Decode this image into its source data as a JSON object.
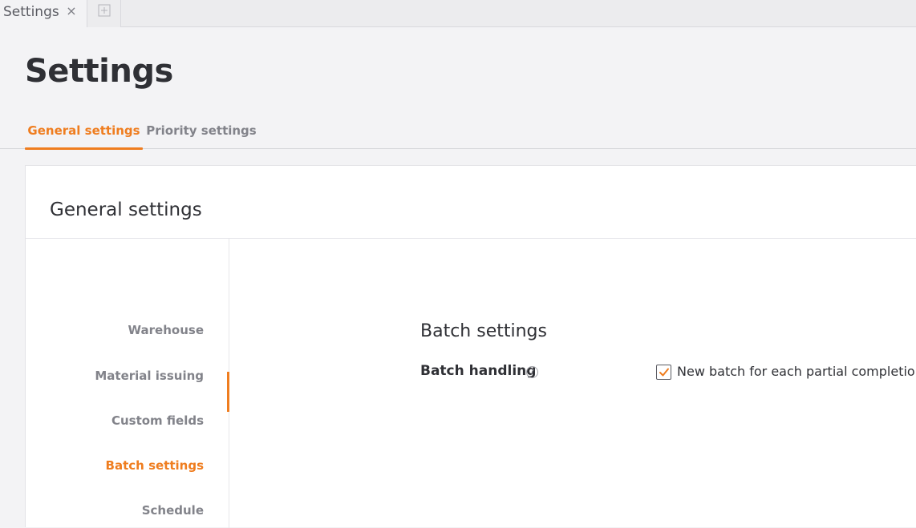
{
  "window": {
    "tab_label": "Settings",
    "close_glyph": "×"
  },
  "page": {
    "title": "Settings",
    "tabs": [
      {
        "label": "General settings",
        "active": true
      },
      {
        "label": "Priority settings",
        "active": false
      }
    ]
  },
  "card": {
    "title": "General settings",
    "nav": [
      {
        "label": "Warehouse",
        "active": false
      },
      {
        "label": "Material issuing",
        "active": false
      },
      {
        "label": "Custom fields",
        "active": false
      },
      {
        "label": "Batch settings",
        "active": true
      },
      {
        "label": "Schedule",
        "active": false
      }
    ],
    "section": {
      "title": "Batch settings",
      "field_label": "Batch handling",
      "help_glyph": "?",
      "checkbox": {
        "label": "New batch for each partial completion",
        "checked": true
      }
    }
  },
  "colors": {
    "accent": "#ef7d1f",
    "text": "#2f3035",
    "muted": "#82838a",
    "background": "#f3f3f5"
  },
  "icons": {
    "close": "close-icon",
    "new_tab": "new-tab-icon",
    "help": "help-icon",
    "check": "checkmark-icon"
  }
}
